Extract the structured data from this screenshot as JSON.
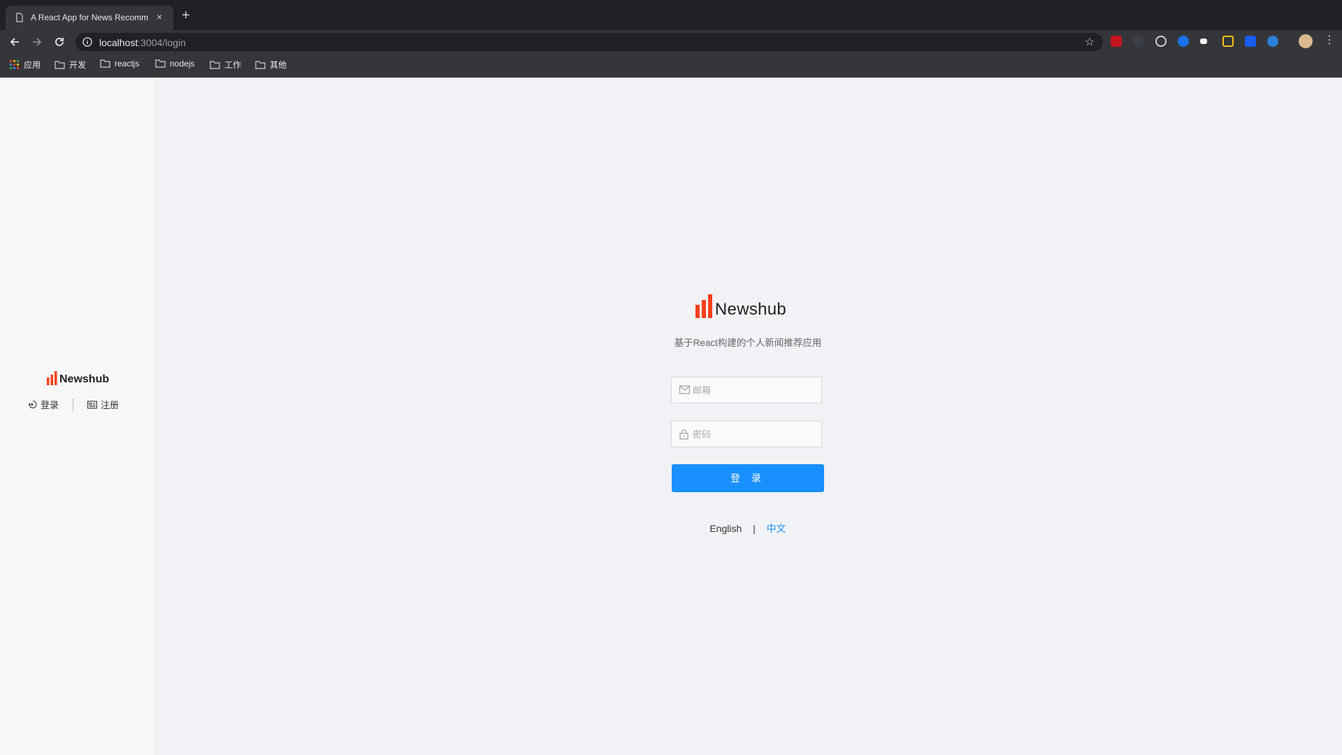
{
  "browser": {
    "tab_title": "A React App for News Recomm",
    "close_glyph": "×",
    "newtab_glyph": "+",
    "url_host": "localhost",
    "url_rest": ":3004/login",
    "bookmarks": [
      "应用",
      "开发",
      "reactjs",
      "nodejs",
      "工作",
      "其他"
    ]
  },
  "sidebar": {
    "logo_text": "Newshub",
    "login_label": "登录",
    "register_label": "注册"
  },
  "login": {
    "logo_text": "Newshub",
    "subtitle": "基于React构建的个人新闻推荐应用",
    "email_placeholder": "邮箱",
    "password_placeholder": "密码",
    "submit_label": "登 录",
    "lang_en": "English",
    "lang_sep": "|",
    "lang_zh": "中文"
  },
  "colors": {
    "accent": "#1890ff",
    "brand": "#f5401b"
  }
}
